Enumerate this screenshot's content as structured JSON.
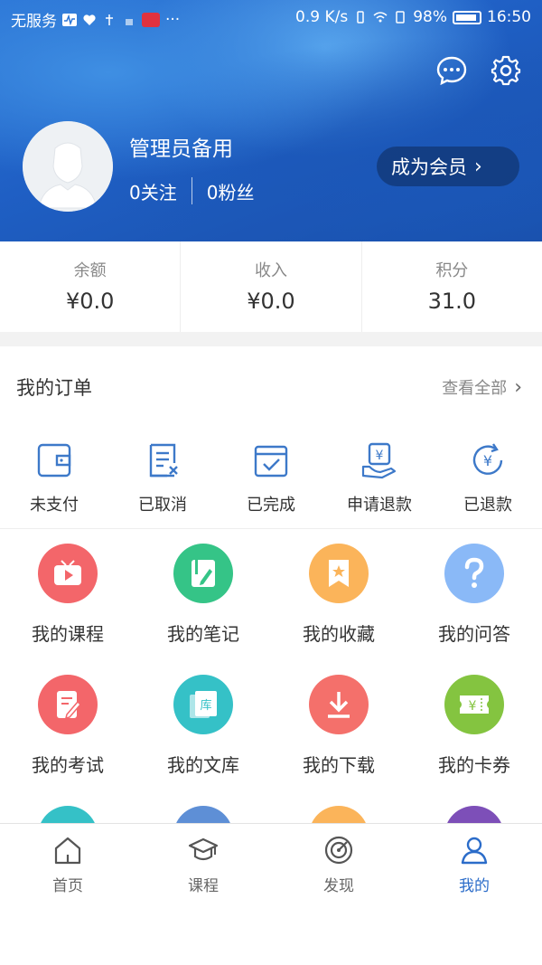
{
  "status_bar": {
    "carrier": "无服务",
    "speed": "0.9 K/s",
    "battery_pct": "98%",
    "time": "16:50",
    "more": "···"
  },
  "profile": {
    "username": "管理员备用",
    "follow": "0关注",
    "fans": "0粉丝",
    "vip_button": "成为会员"
  },
  "stats": [
    {
      "label": "余额",
      "value": "¥0.0"
    },
    {
      "label": "收入",
      "value": "¥0.0"
    },
    {
      "label": "积分",
      "value": "31.0"
    }
  ],
  "orders": {
    "title": "我的订单",
    "view_all": "查看全部",
    "items": [
      {
        "label": "未支付",
        "icon": "wallet-icon"
      },
      {
        "label": "已取消",
        "icon": "cancelled-doc-icon"
      },
      {
        "label": "已完成",
        "icon": "completed-calendar-icon"
      },
      {
        "label": "申请退款",
        "icon": "refund-request-icon"
      },
      {
        "label": "已退款",
        "icon": "refunded-icon"
      }
    ]
  },
  "grid": [
    {
      "label": "我的课程",
      "icon": "video-icon",
      "color": "#f3666a"
    },
    {
      "label": "我的笔记",
      "icon": "note-icon",
      "color": "#35c487"
    },
    {
      "label": "我的收藏",
      "icon": "bookmark-star-icon",
      "color": "#fbb45a"
    },
    {
      "label": "我的问答",
      "icon": "question-icon",
      "color": "#8ab9f7"
    },
    {
      "label": "我的考试",
      "icon": "exam-icon",
      "color": "#f3666a"
    },
    {
      "label": "我的文库",
      "icon": "library-icon",
      "color": "#35c1c7"
    },
    {
      "label": "我的下载",
      "icon": "download-icon",
      "color": "#f4706b"
    },
    {
      "label": "我的卡券",
      "icon": "coupon-icon",
      "color": "#84c440"
    }
  ],
  "grid_partial_colors": [
    "#35c1c7",
    "#5e8fd6",
    "#fbb45a",
    "#7d4fb8"
  ],
  "library_char": "库",
  "coupon_char": "¥",
  "bottom_nav": [
    {
      "label": "首页",
      "icon": "home-icon"
    },
    {
      "label": "课程",
      "icon": "graduation-cap-icon"
    },
    {
      "label": "发现",
      "icon": "discover-radar-icon"
    },
    {
      "label": "我的",
      "icon": "profile-icon"
    }
  ],
  "colors": {
    "accent": "#2b6cc9",
    "header_blue": "#1f5fc4",
    "icon_blue": "#3d79c9"
  }
}
